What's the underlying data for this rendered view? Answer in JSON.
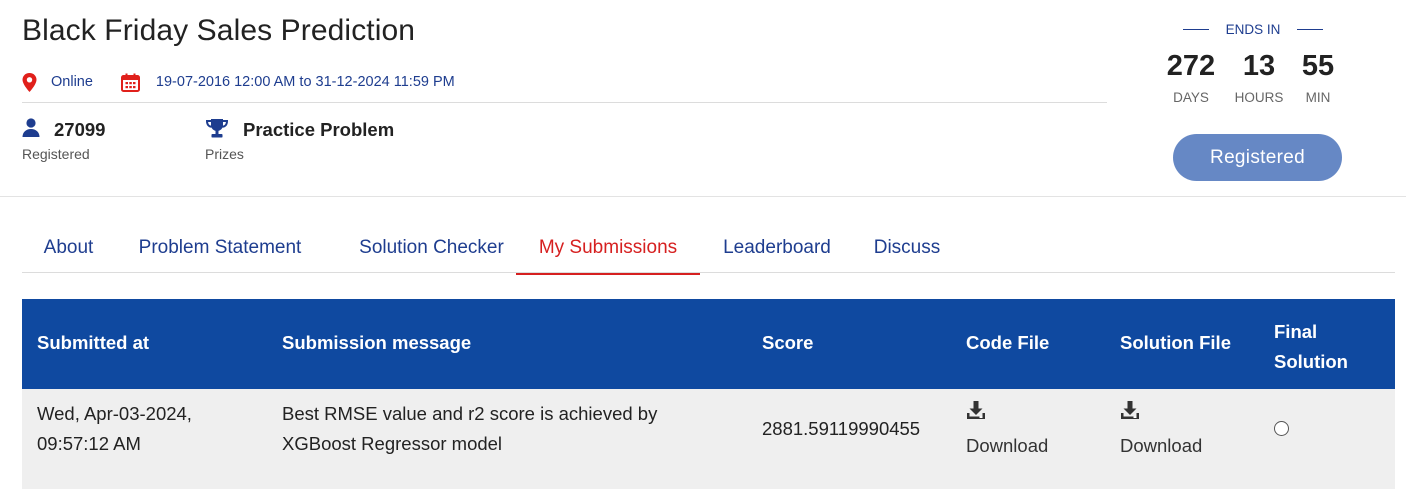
{
  "contest": {
    "title": "Black Friday Sales Prediction",
    "location": "Online",
    "dates": "19-07-2016 12:00 AM to 31-12-2024 11:59 PM",
    "registered_count": "27099",
    "registered_label": "Registered",
    "prize_value": "Practice Problem",
    "prize_label": "Prizes"
  },
  "countdown": {
    "heading": "ENDS IN",
    "days": "272",
    "days_label": "DAYS",
    "hours": "13",
    "hours_label": "HOURS",
    "minutes": "55",
    "minutes_label": "MIN"
  },
  "register_button": "Registered",
  "tabs": [
    {
      "label": "About"
    },
    {
      "label": "Problem Statement"
    },
    {
      "label": "Solution Checker"
    },
    {
      "label": "My Submissions"
    },
    {
      "label": "Leaderboard"
    },
    {
      "label": "Discuss"
    }
  ],
  "active_tab": "My Submissions",
  "table": {
    "headers": {
      "submitted_at": "Submitted at",
      "message": "Submission message",
      "score": "Score",
      "code_file": "Code File",
      "solution_file": "Solution File",
      "final_1": "Final",
      "final_2": "Solution"
    },
    "rows": [
      {
        "submitted_line1": "Wed, Apr-03-2024,",
        "submitted_line2": "09:57:12 AM",
        "message_line1": "Best RMSE value and r2 score is achieved by",
        "message_line2": "XGBoost Regressor model",
        "score": "2881.59119990455",
        "code_file": "Download",
        "solution_file": "Download",
        "final_selected": false
      }
    ]
  },
  "colors": {
    "brand_blue": "#1e3d8f",
    "table_header": "#0f49a0",
    "active_tab": "#d62020",
    "button": "#6688c5",
    "icon_red": "#e0201b"
  },
  "icons": [
    "location-pin-icon",
    "calendar-icon",
    "user-icon",
    "trophy-icon",
    "download-icon"
  ]
}
